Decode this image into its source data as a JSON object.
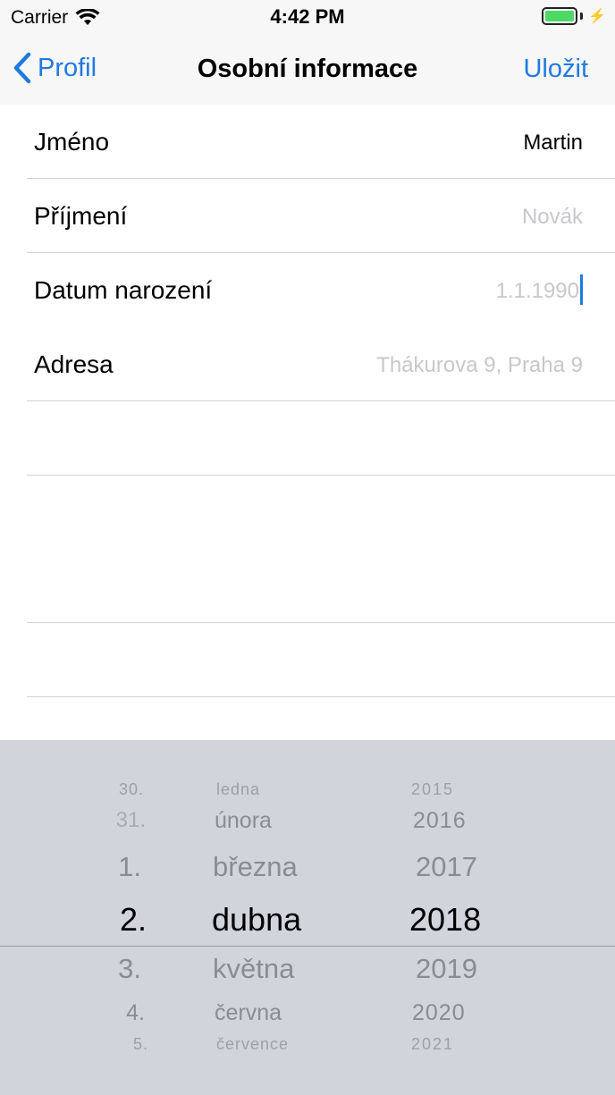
{
  "status_bar": {
    "carrier": "Carrier",
    "time": "4:42 PM",
    "battery_level": 1.0
  },
  "nav": {
    "back_label": "Profil",
    "title": "Osobní informace",
    "save_label": "Uložit"
  },
  "form": {
    "fields": [
      {
        "label": "Jméno",
        "value": "Martin",
        "is_placeholder": false
      },
      {
        "label": "Příjmení",
        "value": "Novák",
        "is_placeholder": true
      },
      {
        "label": "Datum narození",
        "value": "1.1.1990",
        "is_placeholder": true
      },
      {
        "label": "Adresa",
        "value": "Thákurova 9, Praha 9",
        "is_placeholder": true
      }
    ]
  },
  "date_picker": {
    "days": [
      "30.",
      "31.",
      "1.",
      "2.",
      "3.",
      "4.",
      "5."
    ],
    "months": [
      "ledna",
      "února",
      "března",
      "dubna",
      "května",
      "června",
      "července"
    ],
    "years": [
      "2015",
      "2016",
      "2017",
      "2018",
      "2019",
      "2020",
      "2021"
    ],
    "selected": {
      "day": "2.",
      "month": "dubna",
      "year": "2018"
    }
  },
  "colors": {
    "accent": "#1f7ae0",
    "placeholder": "#c7c7cd",
    "picker_bg": "#d1d4db",
    "battery": "#4cd964"
  }
}
